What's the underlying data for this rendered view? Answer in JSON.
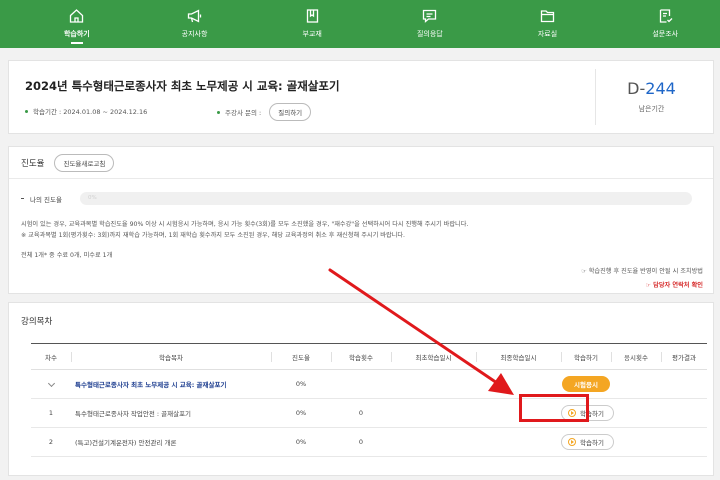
{
  "nav": [
    {
      "label": "학습하기",
      "icon": "home-icon",
      "active": true
    },
    {
      "label": "공지사항",
      "icon": "megaphone-icon",
      "active": false
    },
    {
      "label": "부교재",
      "icon": "book-icon",
      "active": false
    },
    {
      "label": "질의응답",
      "icon": "chat-icon",
      "active": false
    },
    {
      "label": "자료실",
      "icon": "folder-icon",
      "active": false
    },
    {
      "label": "설문조사",
      "icon": "survey-icon",
      "active": false
    }
  ],
  "course": {
    "title": "2024년 특수형태근로종사자 최초 노무제공 시 교육: 골재살포기",
    "period": "학습기간 : 2024.01.08 ~ 2024.12.16",
    "contact_label": "주강사 문의 :",
    "ask_button": "질의하기",
    "dday_prefix": "D-",
    "dday_number": "244",
    "dday_label": "남은기간"
  },
  "progress": {
    "title": "진도율",
    "refresh_button": "진도율새로고침",
    "my_label": "나의 진도율",
    "bar_text": "0%",
    "bar_value_percent": 0,
    "note1": "시험이 있는 경우, 교육과목별 학습진도율 90% 이상 시 시험응시 가능하며, 응시 가능 횟수(3회)를 모두 소진했을 경우, \"재수강\"을 선택하시어 다시 진행해 주시기 바랍니다.",
    "note2": "※ 교육과목별 1회(평가횟수: 3회)까지 재학습 가능하며, 1회 재학습 횟수까지 모두 소진된 경우, 해당 교육과정의 취소 후 재신청해 주시기 바랍니다.",
    "summary": "전체 1개* 중 수료 0개, 미수료 1개",
    "side_note1": "☞ 학습진행 후 진도율 반영이 안될 시 조치방법",
    "side_note2": "☞ 담당자 연락처 확인"
  },
  "lectures": {
    "title": "강의목차",
    "headers": [
      "차수",
      "학습목차",
      "진도율",
      "학습횟수",
      "최초학습일시",
      "최종학습일시",
      "학습하기",
      "응시횟수",
      "평가결과"
    ],
    "group": {
      "title": "특수형태근로종사자 최초 노무제공 시 교육: 골재살포기",
      "progress": "0%",
      "exam_button": "시험응시"
    },
    "rows": [
      {
        "no": "1",
        "title": "특수형태근로종사자 작업안전 : 골재살포기",
        "progress": "0%",
        "count": "0",
        "study_button": "학습하기"
      },
      {
        "no": "2",
        "title": "(특고)건설기계운전자) 안전관리 개론",
        "progress": "0%",
        "count": "0",
        "study_button": "학습하기"
      }
    ]
  },
  "colors": {
    "accent_green": "#3a9a47",
    "highlight_red": "#e0191c",
    "exam_orange": "#f4a623",
    "dday_blue": "#1e66c8"
  }
}
